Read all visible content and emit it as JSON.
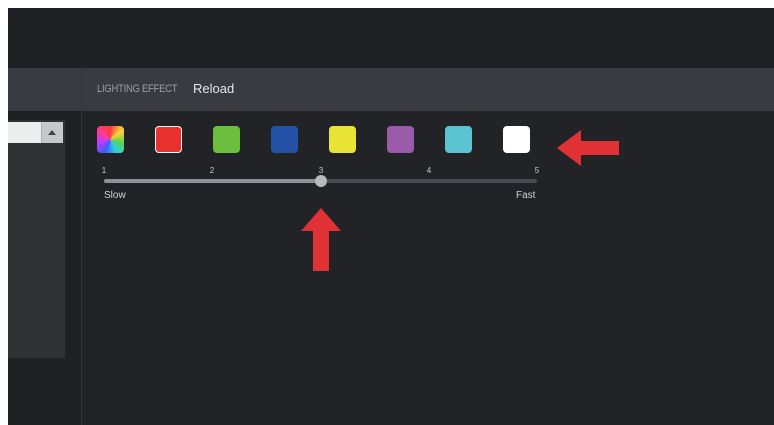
{
  "panel": {
    "header_label": "LIGHTING EFFECT",
    "reload_label": "Reload"
  },
  "colors": [
    {
      "name": "rainbow-swatch",
      "color": "multicolor"
    },
    {
      "name": "red-swatch",
      "color": "#e8302e"
    },
    {
      "name": "green-swatch",
      "color": "#6cbf3e"
    },
    {
      "name": "blue-swatch",
      "color": "#2452a6"
    },
    {
      "name": "yellow-swatch",
      "color": "#e9e336"
    },
    {
      "name": "purple-swatch",
      "color": "#9a5bab"
    },
    {
      "name": "cyan-swatch",
      "color": "#5ac4d2"
    },
    {
      "name": "white-swatch",
      "color": "#ffffff"
    }
  ],
  "speed": {
    "ticks": [
      "1",
      "2",
      "3",
      "4",
      "5"
    ],
    "min_label": "Slow",
    "max_label": "Fast",
    "value": 3
  },
  "annotations": {
    "arrow_color": "#e03134"
  }
}
